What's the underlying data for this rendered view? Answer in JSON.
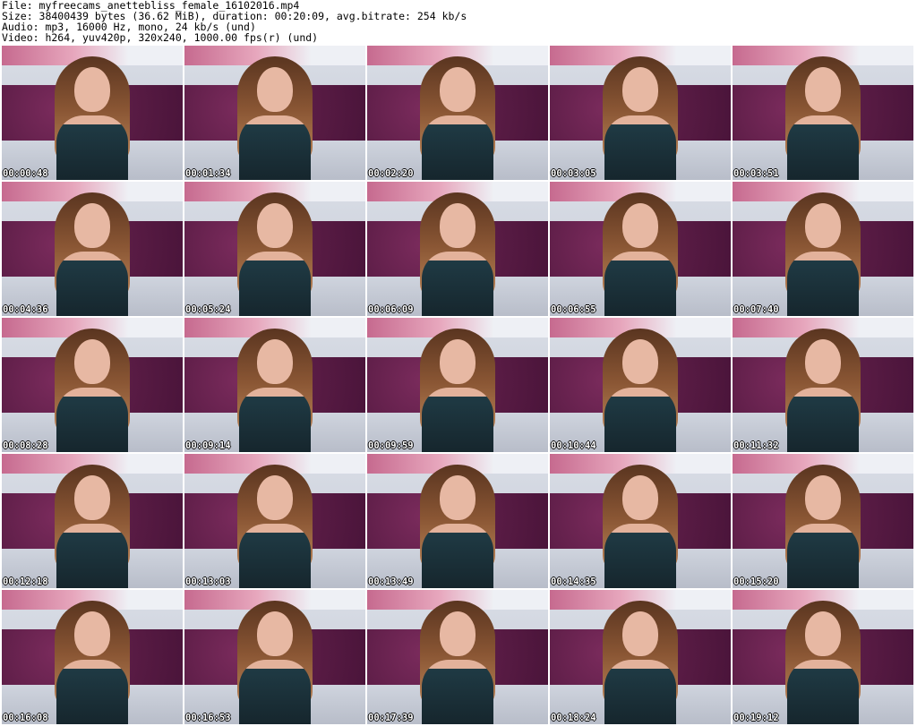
{
  "header": {
    "file_line": "File: myfreecams_anettebliss_female_16102016.mp4",
    "size_line": "Size: 38400439 bytes (36.62 MiB), duration: 00:20:09, avg.bitrate: 254 kb/s",
    "audio_line": "Audio: mp3, 16000 Hz, mono, 24 kb/s (und)",
    "video_line": "Video: h264, yuv420p, 320x240, 1000.00 fps(r) (und)"
  },
  "thumbnails": [
    {
      "timestamp": "00:00:48"
    },
    {
      "timestamp": "00:01:34"
    },
    {
      "timestamp": "00:02:20"
    },
    {
      "timestamp": "00:03:05"
    },
    {
      "timestamp": "00:03:51"
    },
    {
      "timestamp": "00:04:36"
    },
    {
      "timestamp": "00:05:24"
    },
    {
      "timestamp": "00:06:09"
    },
    {
      "timestamp": "00:06:55"
    },
    {
      "timestamp": "00:07:40"
    },
    {
      "timestamp": "00:08:28"
    },
    {
      "timestamp": "00:09:14"
    },
    {
      "timestamp": "00:09:59"
    },
    {
      "timestamp": "00:10:44"
    },
    {
      "timestamp": "00:11:32"
    },
    {
      "timestamp": "00:12:18"
    },
    {
      "timestamp": "00:13:03"
    },
    {
      "timestamp": "00:13:49"
    },
    {
      "timestamp": "00:14:35"
    },
    {
      "timestamp": "00:15:20"
    },
    {
      "timestamp": "00:16:08"
    },
    {
      "timestamp": "00:16:53"
    },
    {
      "timestamp": "00:17:39"
    },
    {
      "timestamp": "00:18:24"
    },
    {
      "timestamp": "00:19:12"
    }
  ]
}
